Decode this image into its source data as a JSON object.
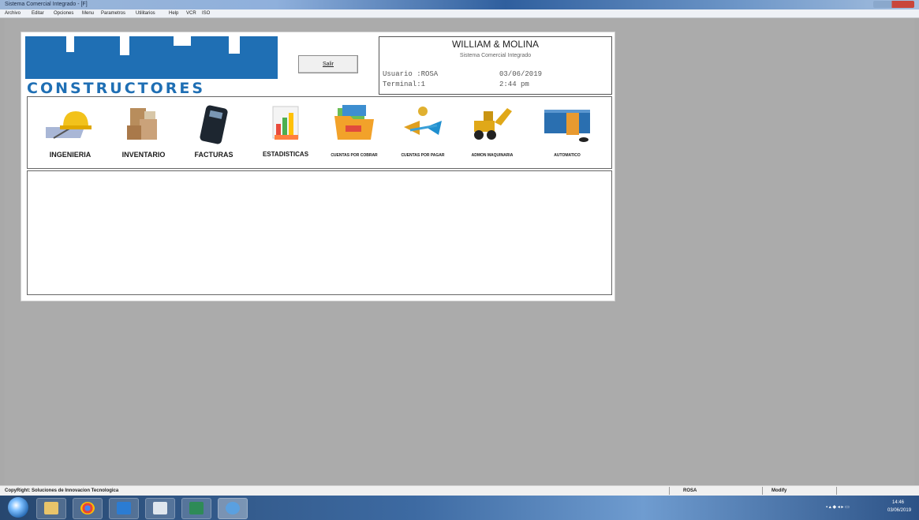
{
  "window": {
    "title": "Sistema Comercial Integrado - [F]"
  },
  "menu": [
    "Archivo",
    "Editar",
    "Opciones",
    "Menu",
    "Parametros",
    "Utilitarios",
    "Help",
    "VCR",
    "ISO"
  ],
  "logo": {
    "text": "CONSTRUCTORES"
  },
  "salir_label": "Salir",
  "info": {
    "company": "WILLIAM & MOLINA",
    "subtitle": "Sistema Comercial Integrado",
    "usuario": "Usuario :ROSA",
    "terminal": "Terminal:1",
    "date": "03/06/2019",
    "time": "2:44 pm"
  },
  "modules": [
    {
      "label": "INGENIERIA",
      "icon": "engineer-helmet-icon"
    },
    {
      "label": "INVENTARIO",
      "icon": "inventory-boxes-icon"
    },
    {
      "label": "FACTURAS",
      "icon": "calculator-icon"
    },
    {
      "label": "ESTADISTICAS",
      "icon": "statistics-chart-icon"
    },
    {
      "label": "CUENTAS POR COBRAR",
      "icon": "folder-money-icon"
    },
    {
      "label": "CUENTAS POR PAGAR",
      "icon": "money-transfer-icon"
    },
    {
      "label": "ADMON MAQUINARIA",
      "icon": "excavator-icon"
    },
    {
      "label": "AUTOMATICO",
      "icon": "container-icon"
    }
  ],
  "status": {
    "copyright": "CopyRight: Soluciones de Innovacion Tecnologica",
    "user": "ROSA",
    "mode": "Modify"
  },
  "taskbar": {
    "time": "14:46",
    "date": "03/06/2019"
  }
}
